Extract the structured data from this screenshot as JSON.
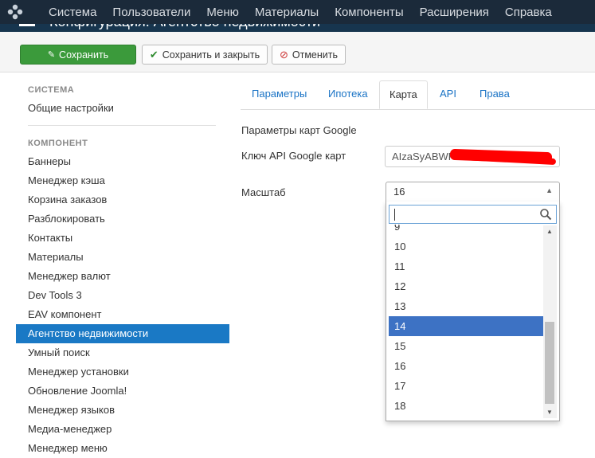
{
  "topbar": {
    "menu": [
      "Система",
      "Пользователи",
      "Меню",
      "Материалы",
      "Компоненты",
      "Расширения",
      "Справка"
    ]
  },
  "titlebar": {
    "title": "Конфигурация: Агентство недвижимости"
  },
  "toolbar": {
    "save_label": "Сохранить",
    "save_close_label": "Сохранить и закрыть",
    "cancel_label": "Отменить"
  },
  "sidebar": {
    "system_heading": "СИСТЕМА",
    "system_items": [
      "Общие настройки"
    ],
    "component_heading": "КОМПОНЕНТ",
    "component_items": [
      "Баннеры",
      "Менеджер кэша",
      "Корзина заказов",
      "Разблокировать",
      "Контакты",
      "Материалы",
      "Менеджер валют",
      "Dev Tools 3",
      "EAV компонент",
      "Агентство недвижимости",
      "Умный поиск",
      "Менеджер установки",
      "Обновление Joomla!",
      "Менеджер языков",
      "Медиа-менеджер",
      "Менеджер меню"
    ],
    "active_item": "Агентство недвижимости"
  },
  "tabs": [
    "Параметры",
    "Ипотека",
    "Карта",
    "API",
    "Права"
  ],
  "active_tab": "Карта",
  "form": {
    "section_label": "Параметры карт Google",
    "api_key_label": "Ключ API Google карт",
    "api_key_value": "AIzaSyABWF",
    "scale_label": "Масштаб",
    "scale_value": "16"
  },
  "dropdown": {
    "search_value": "",
    "options": [
      "9",
      "10",
      "11",
      "12",
      "13",
      "14",
      "15",
      "16",
      "17",
      "18"
    ],
    "highlighted": "14"
  },
  "colors": {
    "navbar": "#1b2a3a",
    "save_button": "#3b9a3b",
    "active_sidebar": "#1a79c5",
    "link": "#1a73c5",
    "highlight": "#3d72c4"
  }
}
